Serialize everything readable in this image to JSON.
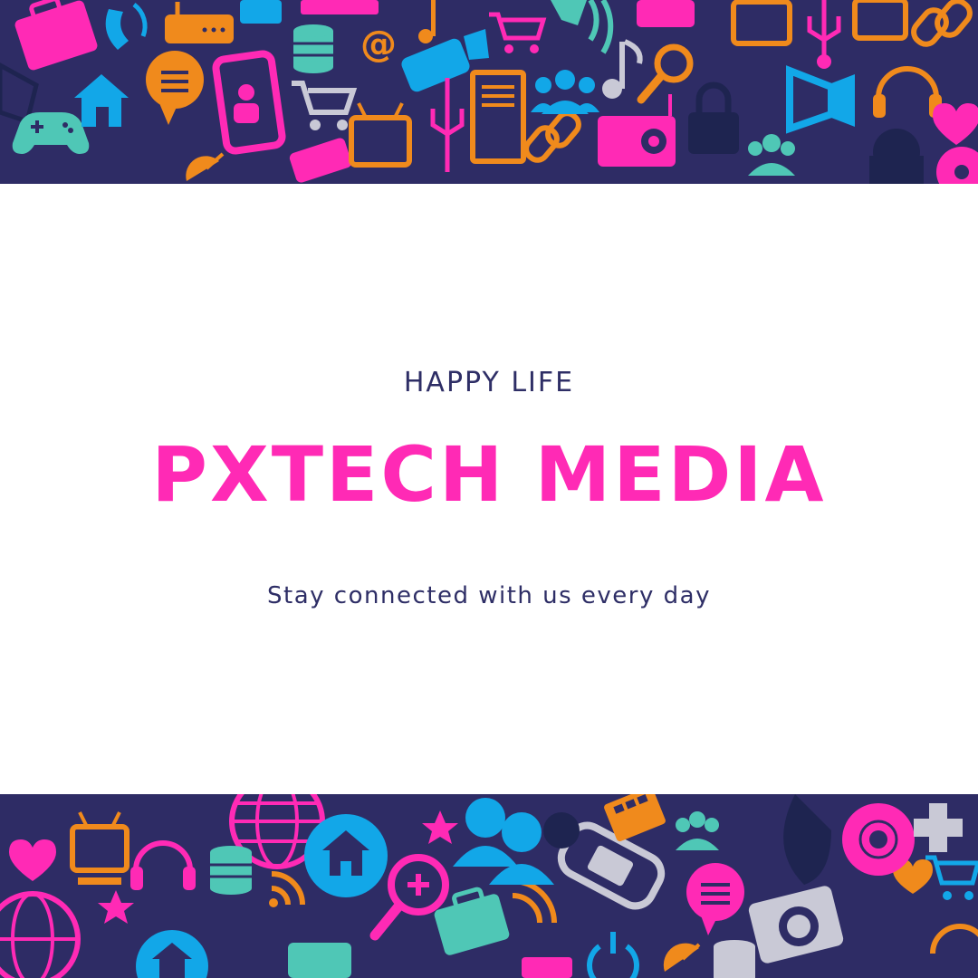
{
  "hero": {
    "kicker": "HAPPY LIFE",
    "headline": "PXTECH MEDIA",
    "tagline": "Stay connected with us every day"
  },
  "pattern": {
    "background_color": "#2e2c65",
    "icon_colors": [
      "#ff2ab5",
      "#f08a1c",
      "#12a7e8",
      "#4fc7b6",
      "#c9c9d6",
      "#1e2450"
    ],
    "top_icons": [
      "briefcase-icon",
      "phone-icon",
      "router-icon",
      "calculator-icon",
      "laptop-icon",
      "database-icon",
      "at-sign-icon",
      "music-note-icon",
      "video-camera-icon",
      "shopping-cart-icon",
      "chat-bubble-icon",
      "speaker-icon",
      "tv-icon",
      "usb-icon",
      "tablet-icon",
      "link-icon",
      "envelope-icon",
      "gamepad-icon",
      "home-icon",
      "smartphone-icon",
      "document-icon",
      "users-icon",
      "magnifier-icon",
      "lock-icon",
      "radio-icon",
      "megaphone-icon",
      "headphones-icon",
      "heart-icon"
    ],
    "bottom_icons": [
      "globe-icon",
      "tv-icon",
      "heart-icon",
      "headphones-icon",
      "star-icon",
      "database-icon",
      "wifi-icon",
      "home-icon",
      "chat-bubble-icon",
      "zoom-in-icon",
      "users-icon",
      "briefcase-icon",
      "handheld-console-icon",
      "calculator-icon",
      "camera-icon",
      "cd-icon",
      "plus-icon",
      "shopping-cart-icon",
      "satellite-icon",
      "power-icon"
    ]
  }
}
